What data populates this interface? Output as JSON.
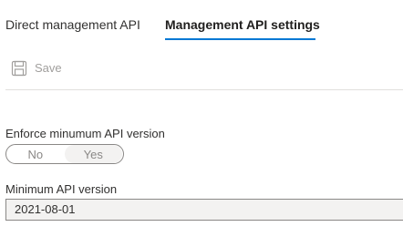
{
  "tabs": [
    {
      "label": "Direct management API",
      "active": false
    },
    {
      "label": "Management API settings",
      "active": true
    }
  ],
  "accent_color": "#0078d4",
  "toolbar": {
    "save_label": "Save",
    "save_icon": "save-icon",
    "save_enabled": false
  },
  "form": {
    "enforce_label": "Enforce minumum API version",
    "toggle_options": [
      "No",
      "Yes"
    ],
    "toggle_selected": "Yes",
    "min_version_label": "Minimum API version",
    "min_version_value": "2021-08-01"
  }
}
